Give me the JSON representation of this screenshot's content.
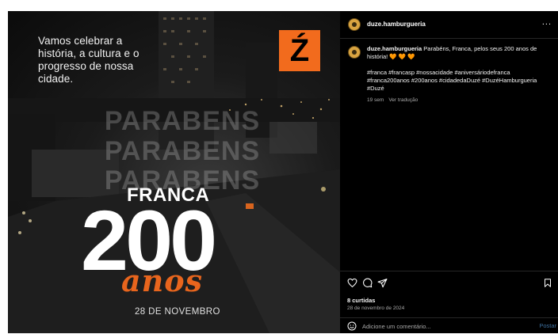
{
  "post_image": {
    "headline": "Vamos celebrar a história, a cultura e o progresso de nossa cidade.",
    "logo": "Ź",
    "watermark_word": "PARABENS",
    "city": "FRANCA",
    "number": "200",
    "anos": "anos",
    "date": "28 DE NOVEMBRO",
    "accent_color": "#f26b1d"
  },
  "header": {
    "username": "duze.hamburgueria",
    "more_icon": "more-horizontal-icon",
    "more_label": "..."
  },
  "caption": {
    "username": "duze.hamburgueria",
    "text": "Parabéns, Franca, pelos seus 200 anos de história! 🧡 🧡 🧡",
    "hashtags": "#franca #francasp #nossacidade #aniversáriodefranca #franca200anos #200anos #cidadedaDuzé #DuzéHamburgueria #Duzé",
    "time_ago": "19 sem",
    "translate_label": "Ver tradução"
  },
  "actions": {
    "icons": [
      "heart-icon",
      "comment-icon",
      "share-icon",
      "bookmark-icon"
    ],
    "likes": "8 curtidas",
    "date": "28 de novembro de 2024"
  },
  "comment": {
    "emoji_icon": "emoji-icon",
    "placeholder": "Adicione um comentário...",
    "post_label": "Postar"
  }
}
